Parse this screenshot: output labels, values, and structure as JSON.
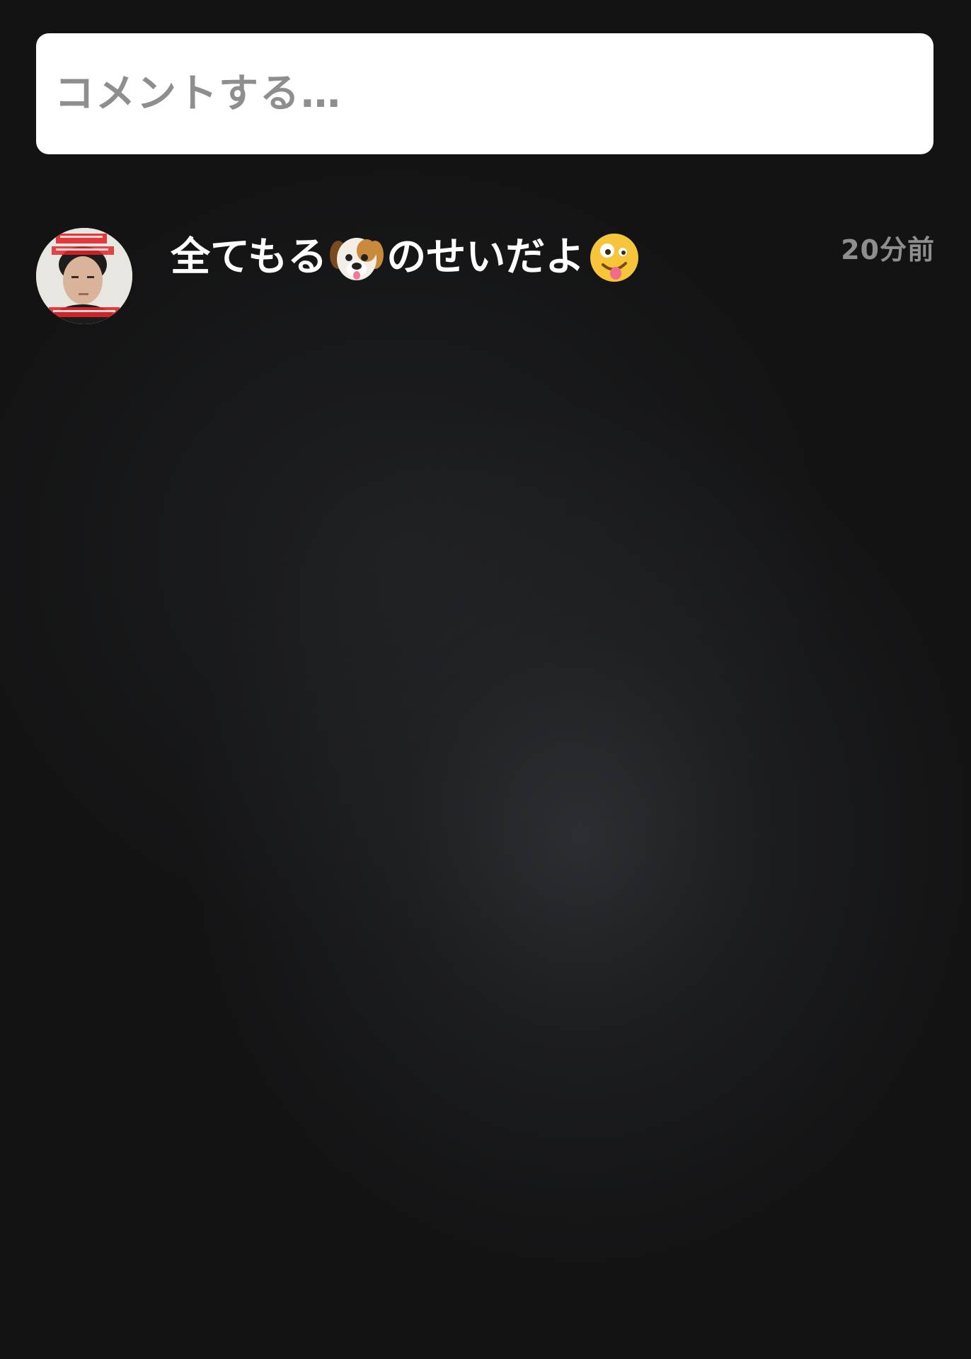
{
  "comment_input": {
    "placeholder": "コメントする…"
  },
  "comments": [
    {
      "avatar_icon": "profile-photo-avatar",
      "text_parts": [
        "全てもる",
        "dog-face-emoji",
        "のせいだよ",
        "zany-face-emoji"
      ],
      "text_segments": {
        "part1": "全てもる",
        "part2": "のせいだよ"
      },
      "time": "20分前"
    }
  ],
  "colors": {
    "background": "#131314",
    "input_background": "#ffffff",
    "placeholder": "#8e8e8e",
    "comment_text": "#ffffff",
    "timestamp": "#8e8e8e"
  }
}
